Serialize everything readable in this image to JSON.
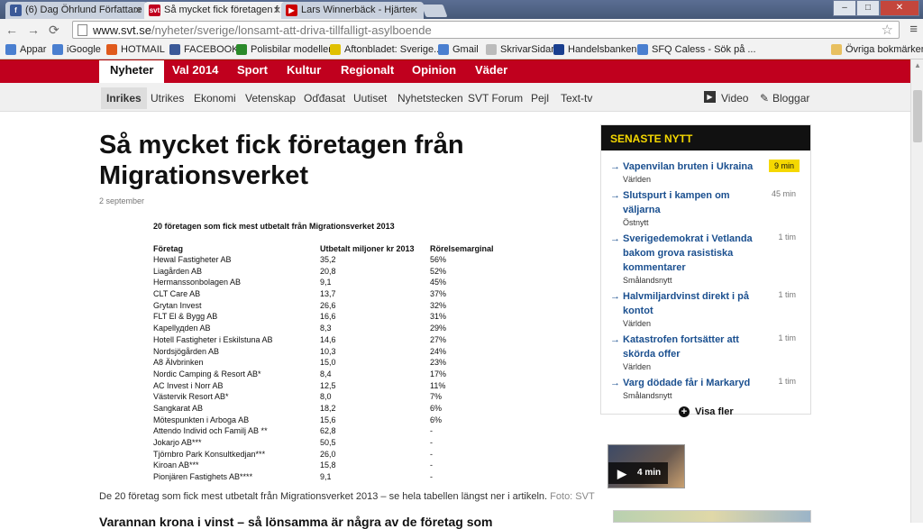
{
  "browser": {
    "tabs": [
      {
        "label": "(6) Dag Öhrlund Författare",
        "icon": "facebook-icon",
        "color": "#3b5998"
      },
      {
        "label": "Så mycket fick företagen f",
        "icon": "svt-icon",
        "color": "#c0001e"
      },
      {
        "label": "Lars Winnerbäck - Hjärter",
        "icon": "youtube-icon",
        "color": "#cc0000"
      }
    ],
    "url_domain": "www.svt.se",
    "url_path": "/nyheter/sverige/lonsamt-att-driva-tillfalligt-asylboende",
    "bookmarks": [
      {
        "label": "Appar",
        "icon": "apps-icon",
        "color": "#4a7fd0"
      },
      {
        "label": "iGoogle",
        "icon": "google-icon",
        "color": "#4a7fd0"
      },
      {
        "label": "HOTMAIL",
        "icon": "windows-icon",
        "color": "#e05a1c"
      },
      {
        "label": "FACEBOOK",
        "icon": "facebook-icon",
        "color": "#3b5998"
      },
      {
        "label": "Polisbilar modeller",
        "icon": "car-icon",
        "color": "#2a8a2a"
      },
      {
        "label": "Aftonbladet: Sverige...",
        "icon": "aftonbladet-icon",
        "color": "#e0c000"
      },
      {
        "label": "Gmail",
        "icon": "google-icon",
        "color": "#4a7fd0"
      },
      {
        "label": "SkrivarSidan",
        "icon": "page-icon",
        "color": "#bbbbbb"
      },
      {
        "label": "Handelsbanken",
        "icon": "bank-icon",
        "color": "#1a3f8f"
      },
      {
        "label": "SFQ Caless - Sök på ...",
        "icon": "google-icon",
        "color": "#4a7fd0"
      }
    ],
    "other_bookmarks": "Övriga bokmärken"
  },
  "site": {
    "main_nav": [
      "Nyheter",
      "Val 2014",
      "Sport",
      "Kultur",
      "Regionalt",
      "Opinion",
      "Väder"
    ],
    "sub_nav": [
      "Inrikes",
      "Utrikes",
      "Ekonomi",
      "Vetenskap",
      "Oďđasat",
      "Uutiset",
      "Nyhetstecken",
      "SVT Forum",
      "Pejl",
      "Text-tv"
    ],
    "video_label": "Video",
    "bloggar_label": "Bloggar"
  },
  "article": {
    "title": "Så mycket fick företagen från Migrationsverket",
    "date": "2 september",
    "caption": "De 20 företag som fick mest utbetalt från Migrationsverket 2013 – se hela tabellen längst ner i artikeln.",
    "caption_source": "Foto: SVT",
    "next_heading": "Varannan krona i vinst – så lönsamma är några av de företag som"
  },
  "table": {
    "title": "20 företagen som fick mest utbetalt från Migrationsverket 2013",
    "headers": [
      "Företag",
      "Utbetalt miljoner kr 2013",
      "Rörelsemarginal"
    ],
    "rows": [
      [
        "Hewal Fastigheter AB",
        "35,2",
        "56%"
      ],
      [
        "Liagården AB",
        "20,8",
        "52%"
      ],
      [
        "Hermanssonbolagen AB",
        "9,1",
        "45%"
      ],
      [
        "CLT Care AB",
        "13,7",
        "37%"
      ],
      [
        "Grytan Invest",
        "26,6",
        "32%"
      ],
      [
        "FLT El & Bygg AB",
        "16,6",
        "31%"
      ],
      [
        "Kapellудden AB",
        "8,3",
        "29%"
      ],
      [
        "Hotell Fastigheter i Eskilstuna AB",
        "14,6",
        "27%"
      ],
      [
        "Nordsjögården AB",
        "10,3",
        "24%"
      ],
      [
        "A8 Älvbrinken",
        "15,0",
        "23%"
      ],
      [
        "Nordic Camping & Resort AB*",
        "8,4",
        "17%"
      ],
      [
        "AC Invest i Norr AB",
        "12,5",
        "11%"
      ],
      [
        "Västervik Resort AB*",
        "8,0",
        "7%"
      ],
      [
        "Sangkarat AB",
        "18,2",
        "6%"
      ],
      [
        "Mötespunkten i Arboga AB",
        "15,6",
        "6%"
      ],
      [
        "Attendo Individ och Familj AB **",
        "62,8",
        "-"
      ],
      [
        "Jokarjo AB***",
        "50,5",
        "-"
      ],
      [
        "Tjörnbro Park Konsultkedjan***",
        "26,0",
        "-"
      ],
      [
        "Kiroan AB***",
        "15,8",
        "-"
      ],
      [
        "Pionjären Fastighets AB****",
        "9,1",
        "-"
      ]
    ]
  },
  "sidebar": {
    "heading": "SENASTE NYTT",
    "items": [
      {
        "title": "Vapenvilan bruten i Ukraina",
        "category": "Världen",
        "time": "9 min"
      },
      {
        "title": "Slutspurt i kampen om väljarna",
        "category": "Östnytt",
        "time": "45 min"
      },
      {
        "title": "Sverigedemokrat i Vetlanda bakom grova rasistiska kommentarer",
        "category": "Smålandsnytt",
        "time": "1 tim"
      },
      {
        "title": "Halvmiljardvinst direkt i på kontot",
        "category": "Världen",
        "time": "1 tim"
      },
      {
        "title": "Katastrofen fortsätter att skörda offer",
        "category": "Världen",
        "time": "1 tim"
      },
      {
        "title": "Varg dödade får i Markaryd",
        "category": "Smålandsnytt",
        "time": "1 tim"
      }
    ],
    "more_label": "Visa fler",
    "video_duration": "4 min"
  }
}
